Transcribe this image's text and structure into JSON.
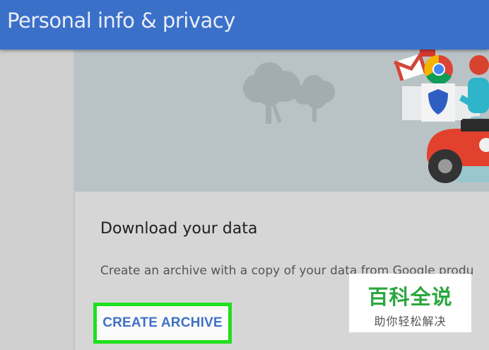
{
  "header": {
    "title": "Personal info & privacy"
  },
  "card": {
    "title": "Download your data",
    "description": "Create an archive with a copy of your data from Google produ",
    "action": {
      "label": "CREATE ARCHIVE"
    }
  },
  "watermark": {
    "main": "百科全说",
    "sub": "助你轻松解决"
  },
  "icons": [
    "trees-illustration",
    "gmail-icon",
    "chrome-icon",
    "shield-icon",
    "scooter-rider-illustration"
  ],
  "colors": {
    "header_bg": "#3b70c9",
    "highlight_border": "#1fe01f",
    "button_text": "#3f72c6",
    "watermark_text": "#2aa63d"
  }
}
